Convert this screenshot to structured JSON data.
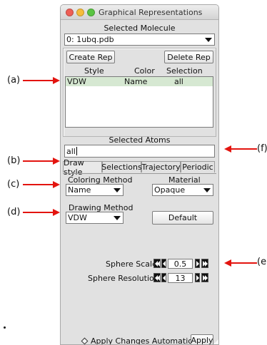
{
  "window": {
    "title": "Graphical Representations",
    "traffic_light_colors": [
      "#ee5e55",
      "#f5bc3a",
      "#5ac442"
    ]
  },
  "selected_molecule": {
    "label": "Selected Molecule",
    "value": "0: 1ubq.pdb"
  },
  "reps": {
    "create_label": "Create Rep",
    "delete_label": "Delete Rep",
    "columns": [
      "Style",
      "Color",
      "Selection"
    ],
    "rows": [
      {
        "style": "VDW",
        "color": "Name",
        "selection": "all"
      }
    ],
    "selected_row_color": "#d6e8d2"
  },
  "selected_atoms": {
    "label": "Selected Atoms",
    "value": "all"
  },
  "tabs": [
    {
      "label": "Draw style",
      "active": true
    },
    {
      "label": "Selections",
      "active": false
    },
    {
      "label": "Trajectory",
      "active": false
    },
    {
      "label": "Periodic",
      "active": false
    }
  ],
  "draw_style": {
    "coloring_method_label": "Coloring Method",
    "coloring_method_value": "Name",
    "material_label": "Material",
    "material_value": "Opaque",
    "drawing_method_label": "Drawing Method",
    "drawing_method_value": "VDW",
    "default_button": "Default",
    "sphere_scale_label": "Sphere Scale",
    "sphere_scale_value": "0.5",
    "sphere_resolution_label": "Sphere Resolution",
    "sphere_resolution_value": "13"
  },
  "footer": {
    "apply_auto_label": "Apply Changes Automatically",
    "apply_auto_icon": "diamond-radio-icon",
    "apply_button": "Apply"
  },
  "annotations": {
    "a": "(a)",
    "b": "(b)",
    "c": "(c)",
    "d": "(d)",
    "e": "(e",
    "f": "(f)",
    "arrow_color": "#e3140f"
  }
}
